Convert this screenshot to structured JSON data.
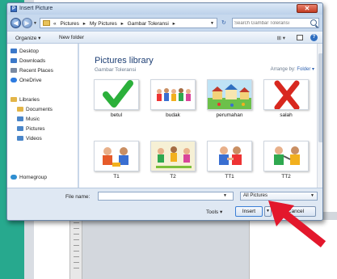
{
  "window": {
    "title": "Insert Picture",
    "close_glyph": "✕",
    "icon_letter": "P"
  },
  "address": {
    "crumbs": [
      "My Pictures",
      "Gambar Toleransi"
    ],
    "crumb_first": "Pictures",
    "search_placeholder": "Search Gambar Toleransi"
  },
  "toolbar": {
    "organize": "Organize ▾",
    "new_folder": "New folder",
    "views": "⊞ ▾"
  },
  "sidebar": {
    "items": [
      {
        "label": "Desktop",
        "color": "#3b78c9"
      },
      {
        "label": "Downloads",
        "color": "#3b78c9"
      },
      {
        "label": "Recent Places",
        "color": "#7a8aa3"
      },
      {
        "label": "OneDrive",
        "color": "#2d7be0"
      },
      {
        "label": "Libraries",
        "color": "#e3b548"
      },
      {
        "label": "Documents",
        "color": "#e3b548"
      },
      {
        "label": "Music",
        "color": "#4a86c9"
      },
      {
        "label": "Pictures",
        "color": "#4a86c9"
      },
      {
        "label": "Videos",
        "color": "#4a86c9"
      },
      {
        "label": "Homegroup",
        "color": "#2f8fd1"
      }
    ]
  },
  "library": {
    "title": "Pictures library",
    "subtitle": "Gambar Toleransi",
    "arrange_label": "Arrange by:",
    "arrange_value": "Folder ▾"
  },
  "files": [
    {
      "name": "betul"
    },
    {
      "name": "budak"
    },
    {
      "name": "perumahan"
    },
    {
      "name": "salah"
    },
    {
      "name": "T1"
    },
    {
      "name": "T2"
    },
    {
      "name": "TT1"
    },
    {
      "name": "TT2"
    }
  ],
  "footer": {
    "file_name_label": "File name:",
    "file_name_value": "",
    "filter": "All Pictures",
    "tools": "Tools ▾",
    "insert": "Insert",
    "cancel": "Cancel"
  },
  "colors": {
    "accent_green": "#27a98e",
    "arrow_red": "#e3172c",
    "check_green": "#2bb03b",
    "cross_red": "#d8281f"
  }
}
